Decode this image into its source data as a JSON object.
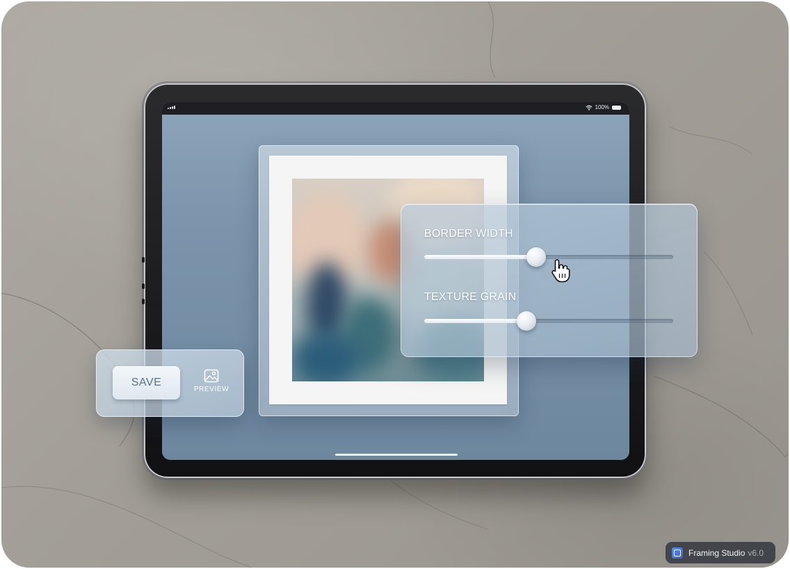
{
  "statusbar": {
    "battery_text": "100%"
  },
  "controls": {
    "border_width": {
      "label": "BORDER WIDTH",
      "value_fraction": 0.45
    },
    "texture_grain": {
      "label": "TEXTURE GRAIN",
      "value_fraction": 0.41
    }
  },
  "actions": {
    "save_label": "SAVE",
    "preview_label": "PREVIEW"
  },
  "badge": {
    "name": "Framing Studio",
    "version": "v6.0"
  },
  "icons": [
    "signal-icon",
    "wifi-icon",
    "battery-icon",
    "image-icon",
    "hand-pointer-cursor-icon",
    "app-logo-icon"
  ],
  "colors": {
    "screen_blue": "#7b94ab",
    "stone_background": "#a29e97",
    "save_text": "#59708a",
    "badge_bg": "#30343c"
  }
}
